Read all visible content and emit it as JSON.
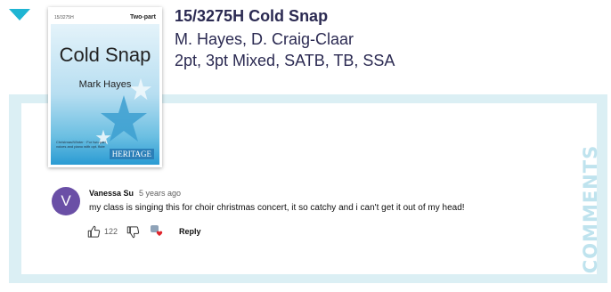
{
  "product": {
    "title": "15/3275H Cold Snap",
    "authors": "M. Hayes, D. Craig-Claar",
    "voicings": "2pt, 3pt Mixed, SATB, TB, SSA"
  },
  "cover": {
    "code": "15/3275H",
    "voicing": "Two-part",
    "title": "Cold Snap",
    "composer": "Mark Hayes",
    "fine_print": "Christmas/Winter · For two-part voices and piano with opt. flute",
    "logo": "HERITAGE"
  },
  "comments_heading": "COMMENTS",
  "comment": {
    "avatar_letter": "V",
    "avatar_color": "#6a4fa6",
    "author": "Vanessa Su",
    "time": "5 years ago",
    "text": "my class is singing this for choir christmas concert, it so catchy and i can't get it out of my head!",
    "likes": "122",
    "reply_label": "Reply"
  },
  "icons": {
    "expand": "caret-down-icon",
    "like": "thumbs-up-icon",
    "dislike": "thumbs-down-icon",
    "creator_heart": "creator-heart-icon"
  },
  "colors": {
    "accent": "#1fb5d3",
    "frame": "#dbeff4",
    "heading_text": "#2b2a52"
  }
}
